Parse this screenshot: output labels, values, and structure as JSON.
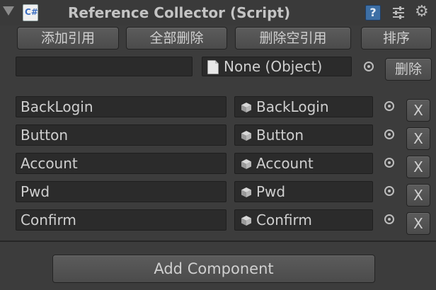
{
  "component": {
    "title": "Reference Collector (Script)",
    "script_icon_text": "C#",
    "help_icon_text": "?"
  },
  "toolbar": {
    "add_label": "添加引用",
    "delete_all_label": "全部删除",
    "delete_empty_label": "删除空引用",
    "sort_label": "排序"
  },
  "new_entry": {
    "key_value": "",
    "object_value": "None (Object)",
    "delete_label": "删除"
  },
  "references": [
    {
      "key": "BackLogin",
      "object": "BackLogin",
      "remove_label": "X"
    },
    {
      "key": "Button",
      "object": "Button",
      "remove_label": "X"
    },
    {
      "key": "Account",
      "object": "Account",
      "remove_label": "X"
    },
    {
      "key": "Pwd",
      "object": "Pwd",
      "remove_label": "X"
    },
    {
      "key": "Confirm",
      "object": "Confirm",
      "remove_label": "X"
    }
  ],
  "footer": {
    "add_component_label": "Add Component"
  }
}
